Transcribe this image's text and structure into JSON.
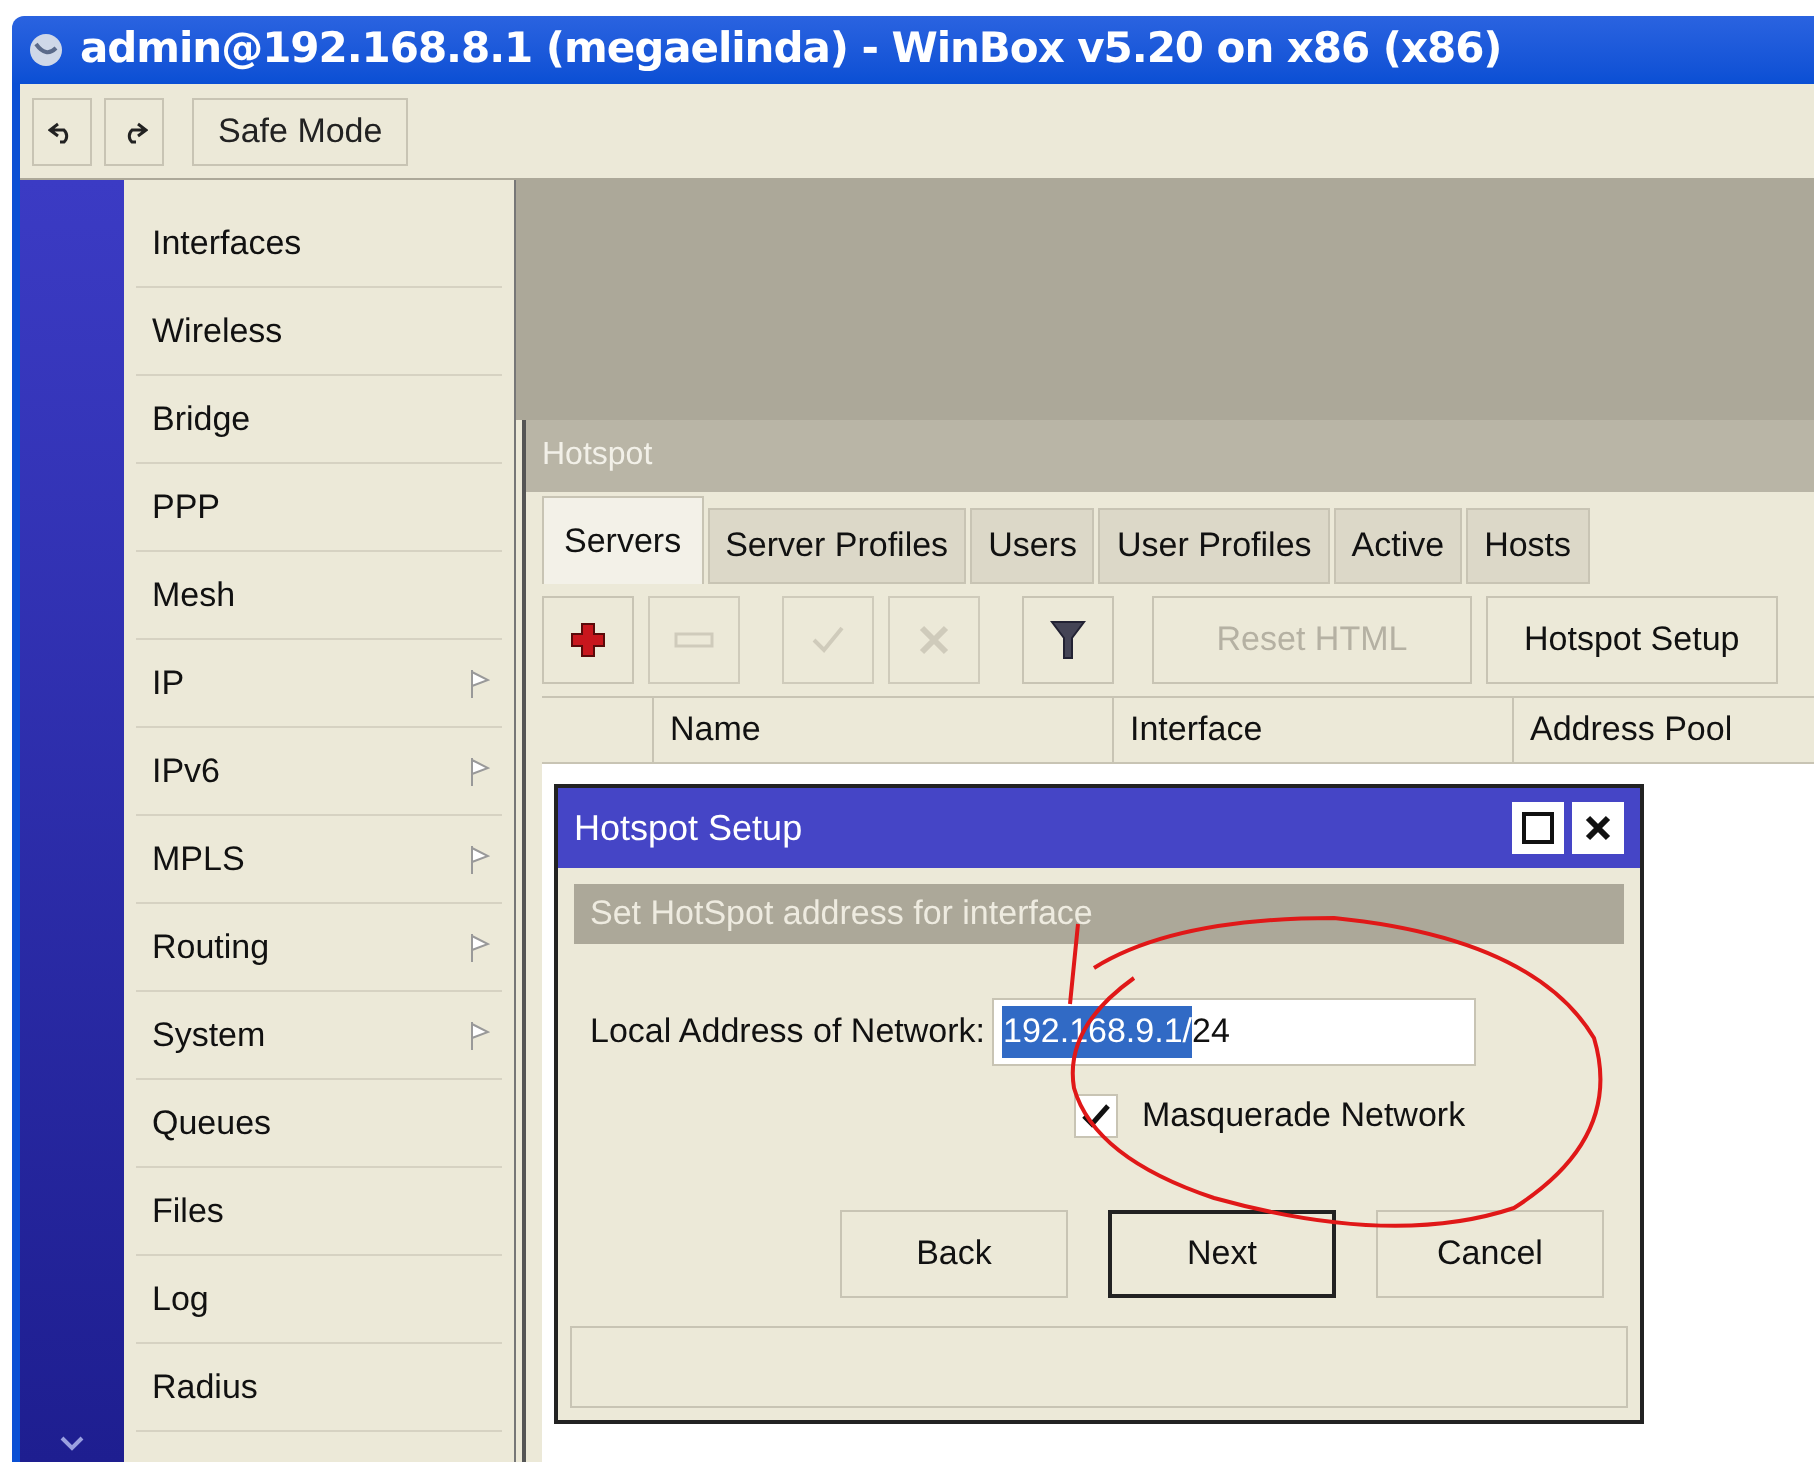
{
  "window": {
    "title": "admin@192.168.8.1 (megaelinda) - WinBox v5.20 on x86 (x86)"
  },
  "toolbar": {
    "safe_mode": "Safe Mode"
  },
  "sidebar": {
    "items": [
      {
        "label": "Interfaces",
        "has_submenu": false
      },
      {
        "label": "Wireless",
        "has_submenu": false
      },
      {
        "label": "Bridge",
        "has_submenu": false
      },
      {
        "label": "PPP",
        "has_submenu": false
      },
      {
        "label": "Mesh",
        "has_submenu": false
      },
      {
        "label": "IP",
        "has_submenu": true
      },
      {
        "label": "IPv6",
        "has_submenu": true
      },
      {
        "label": "MPLS",
        "has_submenu": true
      },
      {
        "label": "Routing",
        "has_submenu": true
      },
      {
        "label": "System",
        "has_submenu": true
      },
      {
        "label": "Queues",
        "has_submenu": false
      },
      {
        "label": "Files",
        "has_submenu": false
      },
      {
        "label": "Log",
        "has_submenu": false
      },
      {
        "label": "Radius",
        "has_submenu": false
      }
    ]
  },
  "hotspot": {
    "title": "Hotspot",
    "tabs": [
      {
        "label": "Servers",
        "selected": true
      },
      {
        "label": "Server Profiles",
        "selected": false
      },
      {
        "label": "Users",
        "selected": false
      },
      {
        "label": "User Profiles",
        "selected": false
      },
      {
        "label": "Active",
        "selected": false
      },
      {
        "label": "Hosts",
        "selected": false
      }
    ],
    "tools": [
      {
        "kind": "add",
        "disabled": false
      },
      {
        "kind": "remove",
        "disabled": true
      },
      {
        "kind": "enable",
        "disabled": true
      },
      {
        "kind": "disable",
        "disabled": true
      },
      {
        "kind": "filter",
        "disabled": false
      }
    ],
    "text_buttons": [
      {
        "label": "Reset HTML",
        "disabled": true
      },
      {
        "label": "Hotspot Setup",
        "disabled": false
      }
    ],
    "columns": [
      "Name",
      "Interface",
      "Address Pool"
    ]
  },
  "dialog": {
    "title": "Hotspot Setup",
    "subtitle": "Set HotSpot address for interface",
    "field": {
      "label": "Local Address of Network:",
      "value_selected": "192.168.9.1/",
      "value_rest": "24"
    },
    "checkbox": {
      "label": "Masquerade Network",
      "checked": true
    },
    "buttons": [
      {
        "label": "Back",
        "default": false
      },
      {
        "label": "Next",
        "default": true
      },
      {
        "label": "Cancel",
        "default": false
      }
    ]
  }
}
